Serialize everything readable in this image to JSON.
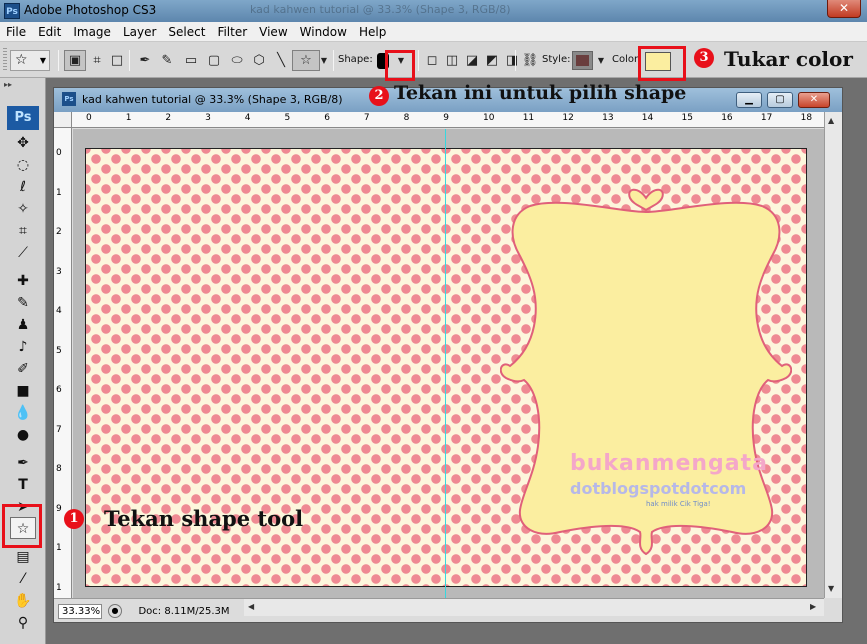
{
  "window": {
    "app_title": "Adobe Photoshop CS3",
    "ghost_text": "kad kahwen tutorial @ 33.3% (Shape 3, RGB/8)",
    "close_glyph": "✕"
  },
  "menu": [
    "File",
    "Edit",
    "Image",
    "Layer",
    "Select",
    "Filter",
    "View",
    "Window",
    "Help"
  ],
  "options": {
    "tool_preset_icon": "custom-shape-icon",
    "shape_label": "Shape:",
    "style_label": "Style:",
    "color_label": "Color:",
    "color_value": "#fbeea0",
    "style_color": "#6a3e3e"
  },
  "annotations": {
    "step1_number": "1",
    "step1_text": "Tekan shape tool",
    "step2_number": "2",
    "step2_text": "Tekan ini untuk pilih shape",
    "step3_number": "3",
    "step3_text": "Tukar color"
  },
  "document": {
    "title": "kad kahwen tutorial @ 33.3% (Shape 3, RGB/8)",
    "zoom": "33.33%",
    "doc_info": "Doc: 8.11M/25.3M",
    "ruler_h_labels": [
      "0",
      "1",
      "2",
      "3",
      "4",
      "5",
      "6",
      "7",
      "8",
      "9",
      "10",
      "11",
      "12",
      "13",
      "14",
      "15",
      "16",
      "17",
      "18"
    ],
    "ruler_v_labels": [
      "0",
      "1",
      "2",
      "3",
      "4",
      "5",
      "6",
      "7",
      "8",
      "9",
      "1",
      "1"
    ],
    "watermark_line1": "bukanmengata",
    "watermark_line2": "dotblogspotdotcom",
    "watermark_line3": "hak milik Cik Tiga!"
  },
  "colors": {
    "accent_red": "#e8101a",
    "dots": "#ef8a93",
    "background": "#fdf6dc",
    "frame_fill": "#fbeea0",
    "frame_stroke": "#e0607a"
  }
}
